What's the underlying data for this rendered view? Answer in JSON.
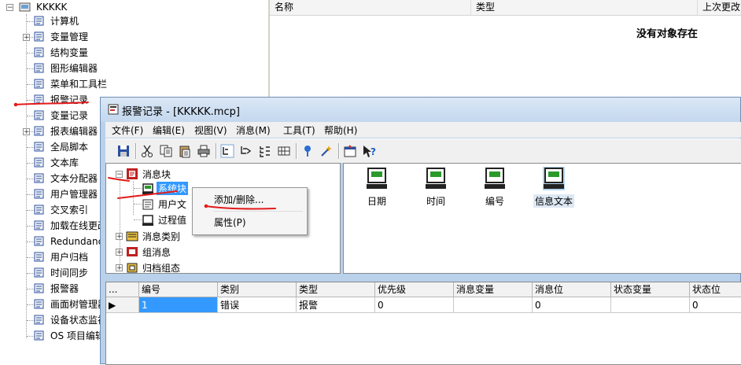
{
  "background": {
    "tree": {
      "root": "KKKKK",
      "items": [
        {
          "label": "计算机",
          "icon": "computer-icon",
          "expandable": false
        },
        {
          "label": "变量管理",
          "icon": "tag-manager-icon",
          "expandable": true
        },
        {
          "label": "结构变量",
          "icon": "struct-tag-icon",
          "expandable": false
        },
        {
          "label": "图形编辑器",
          "icon": "graphics-designer-icon",
          "expandable": false
        },
        {
          "label": "菜单和工具栏",
          "icon": "menu-toolbar-icon",
          "expandable": false
        },
        {
          "label": "报警记录",
          "icon": "alarm-logging-icon",
          "expandable": false
        },
        {
          "label": "变量记录",
          "icon": "tag-logging-icon",
          "expandable": false
        },
        {
          "label": "报表编辑器",
          "icon": "report-designer-icon",
          "expandable": true
        },
        {
          "label": "全局脚本",
          "icon": "global-script-icon",
          "expandable": false
        },
        {
          "label": "文本库",
          "icon": "text-library-icon",
          "expandable": false
        },
        {
          "label": "文本分配器",
          "icon": "text-distributor-icon",
          "expandable": false
        },
        {
          "label": "用户管理器",
          "icon": "user-admin-icon",
          "expandable": false
        },
        {
          "label": "交叉索引",
          "icon": "cross-reference-icon",
          "expandable": false
        },
        {
          "label": "加载在线更改",
          "icon": "load-online-changes-icon",
          "expandable": false
        },
        {
          "label": "Redundancy",
          "icon": "redundancy-icon",
          "expandable": false
        },
        {
          "label": "用户归档",
          "icon": "user-archive-icon",
          "expandable": false
        },
        {
          "label": "时间同步",
          "icon": "time-sync-icon",
          "expandable": false
        },
        {
          "label": "报警器",
          "icon": "horn-icon",
          "expandable": false
        },
        {
          "label": "画面树管理器",
          "icon": "picture-tree-icon",
          "expandable": false
        },
        {
          "label": "设备状态监视",
          "icon": "device-status-icon",
          "expandable": false
        },
        {
          "label": "OS 项目编辑器",
          "icon": "os-project-editor-icon",
          "expandable": false
        }
      ]
    },
    "list": {
      "columns": [
        "名称",
        "类型",
        "上次更改"
      ],
      "empty_message": "没有对象存在"
    }
  },
  "window": {
    "title": "报警记录 - [KKKKK.mcp]",
    "menu": [
      "文件(F)",
      "编辑(E)",
      "视图(V)",
      "消息(M)",
      "工具(T)",
      "帮助(H)"
    ],
    "toolbar_icons": [
      "save-icon",
      "cut-icon",
      "copy-icon",
      "paste-icon",
      "print-icon",
      "view-1-icon",
      "view-2-icon",
      "view-3-icon",
      "view-4-icon",
      "filter-icon",
      "wizard-icon",
      "properties-icon",
      "help-icon"
    ],
    "tree": {
      "root": "消息块",
      "children": [
        "系统块",
        "用户文",
        "过程值"
      ],
      "siblings": [
        "消息类别",
        "组消息",
        "归档组态"
      ]
    },
    "context_menu": {
      "items": [
        "添加/删除...",
        "属性(P)"
      ]
    },
    "blocks": [
      {
        "label": "日期",
        "selected": false
      },
      {
        "label": "时间",
        "selected": false
      },
      {
        "label": "编号",
        "selected": false
      },
      {
        "label": "信息文本",
        "selected": true
      }
    ],
    "grid": {
      "columns": [
        "...",
        "编号",
        "类别",
        "类型",
        "优先级",
        "消息变量",
        "消息位",
        "状态变量",
        "状态位"
      ],
      "rows": [
        {
          "marker": "▶",
          "cells": [
            "1",
            "错误",
            "报警",
            "0",
            "",
            "0",
            "",
            "0"
          ]
        }
      ]
    }
  },
  "colors": {
    "annotation_red": "#e31b1b",
    "selection_blue": "#3399ff",
    "window_frame": "#b9d1ea"
  }
}
